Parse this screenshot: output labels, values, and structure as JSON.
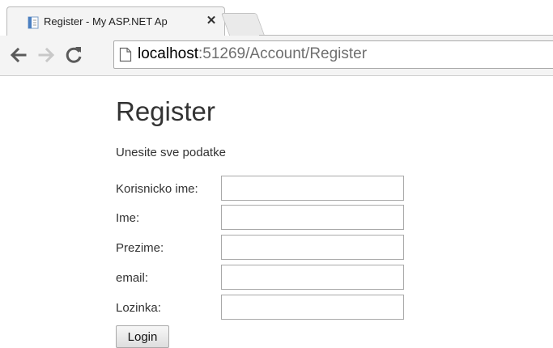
{
  "browser": {
    "tab_title": "Register - My ASP.NET Ap",
    "tab_close": "✕",
    "url_host": "localhost",
    "url_rest": ":51269/Account/Register"
  },
  "page": {
    "title": "Register",
    "subtitle": "Unesite sve podatke",
    "fields": [
      {
        "label": "Korisnicko ime:",
        "value": ""
      },
      {
        "label": "Ime:",
        "value": ""
      },
      {
        "label": "Prezime:",
        "value": ""
      },
      {
        "label": "email:",
        "value": ""
      },
      {
        "label": "Lozinka:",
        "value": ""
      }
    ],
    "login_label": "Login"
  },
  "icons": {
    "back": "arrow-left-icon",
    "forward": "arrow-right-icon",
    "reload": "reload-icon",
    "page": "page-icon",
    "favicon": "document-favicon-icon"
  },
  "colors": {
    "chrome_bg": "#f4f4f4",
    "text": "#333333",
    "url_host": "#000000",
    "url_rest": "#6f6f6f"
  }
}
